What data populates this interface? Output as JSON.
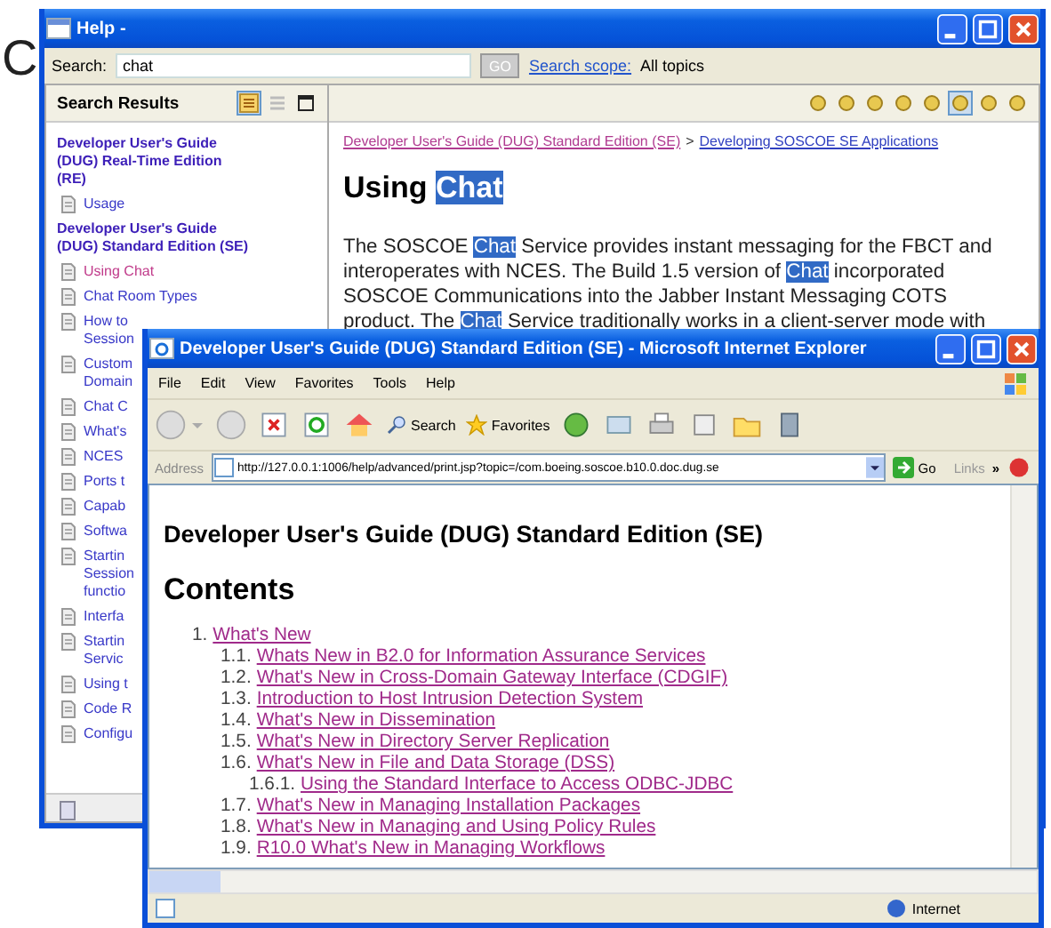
{
  "slide_fragment": "C",
  "help_window": {
    "title": "Help -",
    "search_label": "Search:",
    "search_value": "chat",
    "go_button": "GO",
    "scope_link": "Search scope:",
    "scope_value": "All topics",
    "results_title": "Search Results",
    "results": [
      {
        "kind": "group",
        "lines": [
          "Developer User's Guide",
          "(DUG) Real-Time Edition",
          "(RE)"
        ]
      },
      {
        "kind": "topic",
        "lines": [
          "Usage"
        ],
        "visited": false
      },
      {
        "kind": "group",
        "lines": [
          "Developer User's Guide",
          "(DUG) Standard Edition (SE)"
        ]
      },
      {
        "kind": "topic",
        "lines": [
          "Using Chat"
        ],
        "visited": true
      },
      {
        "kind": "topic",
        "lines": [
          "Chat Room Types"
        ],
        "visited": false
      },
      {
        "kind": "topic",
        "lines": [
          "How to",
          "Session"
        ],
        "visited": false
      },
      {
        "kind": "topic",
        "lines": [
          "Custom",
          "Domain"
        ],
        "visited": false
      },
      {
        "kind": "topic",
        "lines": [
          "Chat C"
        ],
        "visited": false
      },
      {
        "kind": "topic",
        "lines": [
          "What's"
        ],
        "visited": false
      },
      {
        "kind": "topic",
        "lines": [
          "NCES"
        ],
        "visited": false
      },
      {
        "kind": "topic",
        "lines": [
          "Ports t"
        ],
        "visited": false
      },
      {
        "kind": "topic",
        "lines": [
          "Capab"
        ],
        "visited": false
      },
      {
        "kind": "topic",
        "lines": [
          "Softwa"
        ],
        "visited": false
      },
      {
        "kind": "topic",
        "lines": [
          "Startin",
          "Session",
          "functio"
        ],
        "visited": false
      },
      {
        "kind": "topic",
        "lines": [
          "Interfa"
        ],
        "visited": false
      },
      {
        "kind": "topic",
        "lines": [
          "Startin",
          "Servic"
        ],
        "visited": false
      },
      {
        "kind": "topic",
        "lines": [
          "Using t"
        ],
        "visited": false
      },
      {
        "kind": "topic",
        "lines": [
          "Code R"
        ],
        "visited": false
      },
      {
        "kind": "topic",
        "lines": [
          "Configu"
        ],
        "visited": false
      }
    ],
    "breadcrumb": [
      {
        "text": "Developer User's Guide (DUG) Standard Edition (SE)",
        "visited": true
      },
      {
        "text": "Developing SOSCOE SE Applications",
        "visited": false
      }
    ],
    "breadcrumb_separator": ">",
    "heading": [
      {
        "text": "Using ",
        "hit": false
      },
      {
        "text": "Chat",
        "hit": true
      }
    ],
    "paragraph_lines": [
      [
        {
          "text": "The SOSCOE ",
          "hit": false
        },
        {
          "text": "Chat",
          "hit": true
        },
        {
          "text": " Service provides instant messaging for the FBCT and",
          "hit": false
        }
      ],
      [
        {
          "text": "interoperates with NCES. The Build 1.5 version of ",
          "hit": false
        },
        {
          "text": "Chat",
          "hit": true
        },
        {
          "text": " incorporated",
          "hit": false
        }
      ],
      [
        {
          "text": "SOSCOE Communications into the Jabber Instant Messaging COTS",
          "hit": false
        }
      ],
      [
        {
          "text": "product. The ",
          "hit": false
        },
        {
          "text": "Chat",
          "hit": true
        },
        {
          "text": " Service traditionally works in a client-server mode with",
          "hit": false
        }
      ]
    ]
  },
  "ie_window": {
    "title": "Developer User's Guide (DUG) Standard Edition (SE) - Microsoft Internet Explorer",
    "menu": [
      "File",
      "Edit",
      "View",
      "Favorites",
      "Tools",
      "Help"
    ],
    "search_button": "Search",
    "favorites_button": "Favorites",
    "address_label": "Address",
    "url": "http://127.0.0.1:1006/help/advanced/print.jsp?topic=/com.boeing.soscoe.b10.0.doc.dug.se",
    "go_button": "Go",
    "links_label": "Links",
    "links_more": "»",
    "page_title": "Developer User's Guide (DUG) Standard Edition (SE)",
    "contents_heading": "Contents",
    "toc": [
      {
        "number": "1.",
        "text": "What's New",
        "children": [
          {
            "number": "1.1.",
            "text": "Whats New in B2.0 for Information Assurance Services"
          },
          {
            "number": "1.2.",
            "text": "What's New in Cross-Domain Gateway Interface (CDGIF)"
          },
          {
            "number": "1.3.",
            "text": "Introduction to Host Intrusion Detection System"
          },
          {
            "number": "1.4.",
            "text": "What's New in Dissemination"
          },
          {
            "number": "1.5.",
            "text": "What's New in Directory Server Replication"
          },
          {
            "number": "1.6.",
            "text": "What's New in File and Data Storage (DSS)",
            "children": [
              {
                "number": "1.6.1.",
                "text": "Using the Standard Interface to Access ODBC-JDBC"
              }
            ]
          },
          {
            "number": "1.7.",
            "text": "What's New in Managing Installation Packages"
          },
          {
            "number": "1.8.",
            "text": "What's New in Managing and Using Policy Rules"
          },
          {
            "number": "1.9.",
            "text": "R10.0 What's New in Managing Workflows"
          }
        ]
      }
    ],
    "status_zone": "Internet"
  }
}
